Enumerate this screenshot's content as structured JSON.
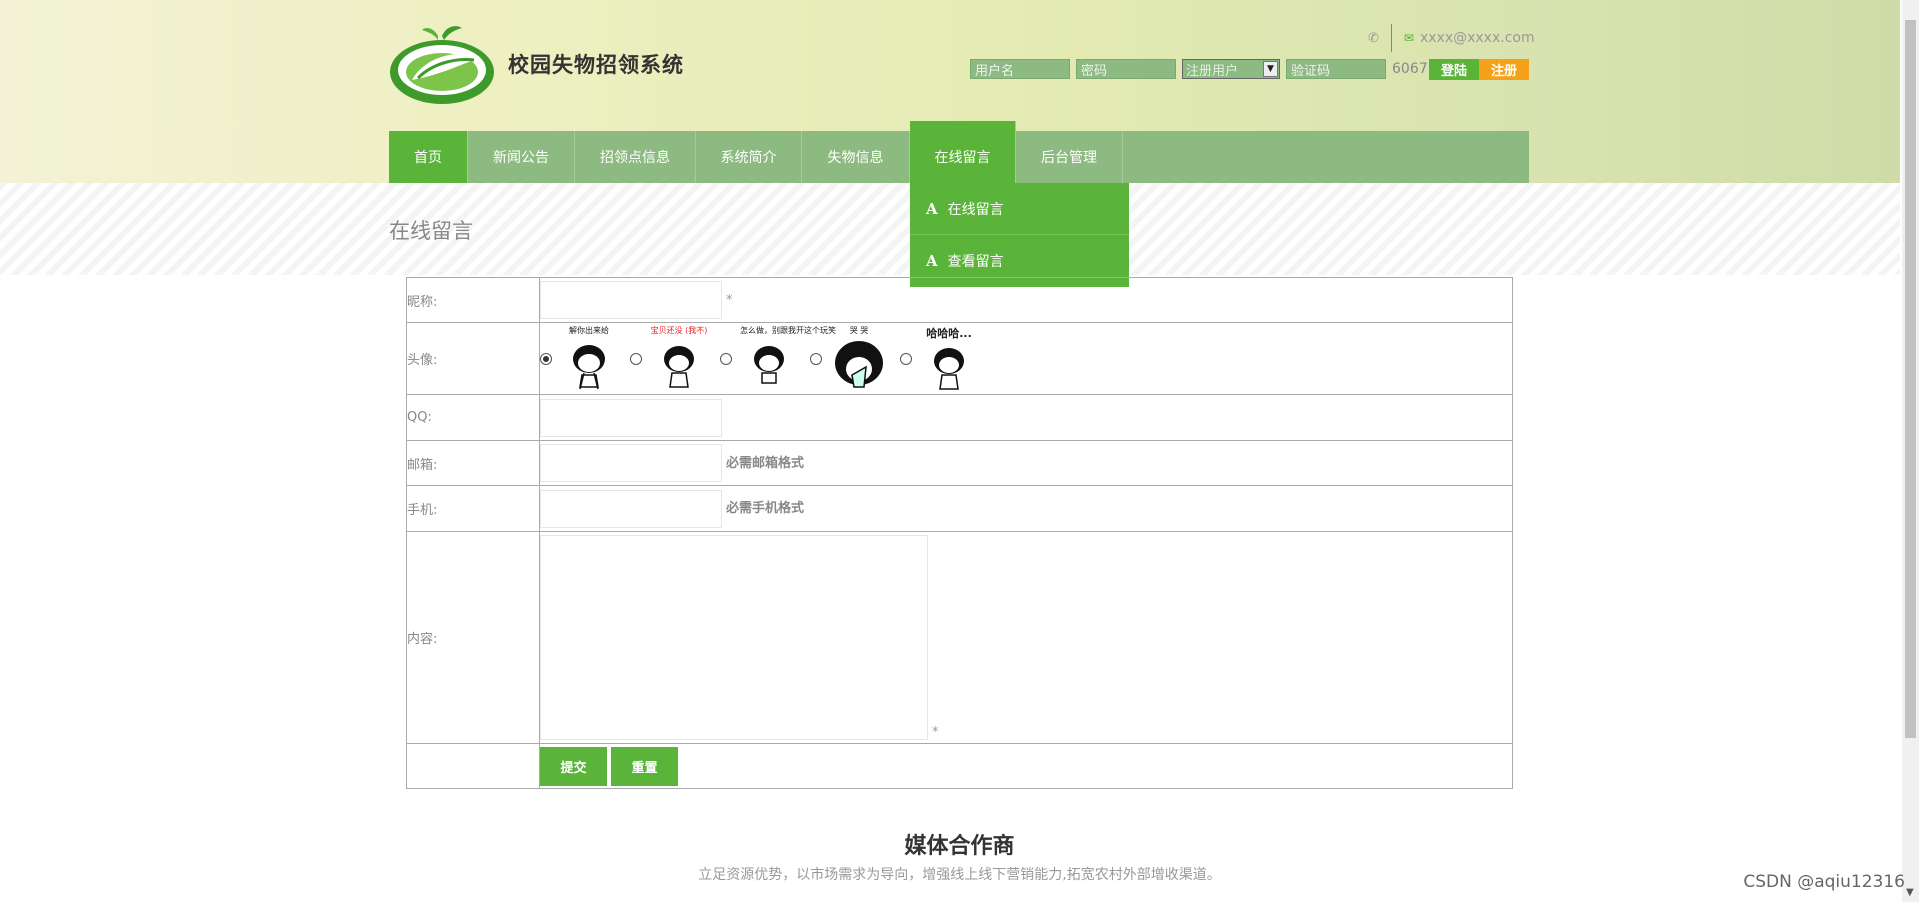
{
  "site": {
    "title": "校园失物招领系统",
    "email": "xxxx@xxxx.com"
  },
  "login": {
    "username_placeholder": "用户名",
    "password_placeholder": "密码",
    "role_selected": "注册用户",
    "captcha_placeholder": "验证码",
    "captcha_code": "6067",
    "login_label": "登陆",
    "register_label": "注册"
  },
  "nav": {
    "items": [
      {
        "label": "首页"
      },
      {
        "label": "新闻公告"
      },
      {
        "label": "招领点信息"
      },
      {
        "label": "系统简介"
      },
      {
        "label": "失物信息"
      },
      {
        "label": "在线留言"
      },
      {
        "label": "后台管理"
      }
    ],
    "dropdown": [
      {
        "icon": "A",
        "label": "在线留言"
      },
      {
        "icon": "A",
        "label": "查看留言"
      }
    ]
  },
  "page": {
    "heading": "在线留言"
  },
  "form": {
    "nickname_label": "昵称:",
    "avatar_label": "头像:",
    "qq_label": "QQ:",
    "email_label": "邮箱:",
    "email_hint": "必需邮箱格式",
    "phone_label": "手机:",
    "phone_hint": "必需手机格式",
    "content_label": "内容:",
    "required_mark": "*",
    "avatars": [
      {
        "caption": "解你出来给",
        "selected": true
      },
      {
        "caption": "宝贝还没 (我不)",
        "selected": false
      },
      {
        "caption": "怎么做，别跟我开这个玩笑",
        "selected": false
      },
      {
        "caption": "哭 哭",
        "selected": false
      },
      {
        "caption": "哈哈哈...",
        "selected": false
      }
    ],
    "submit_label": "提交",
    "reset_label": "重置"
  },
  "partners": {
    "title": "媒体合作商",
    "subtitle": "立足资源优势，以市场需求为导向，增强线上线下营销能力,拓宽农村外部增收渠道。"
  },
  "watermark": "CSDN @aqiu12316",
  "colors": {
    "accent_green": "#5ab43a",
    "nav_green": "#8dba80",
    "register_orange": "#f5a11a"
  }
}
